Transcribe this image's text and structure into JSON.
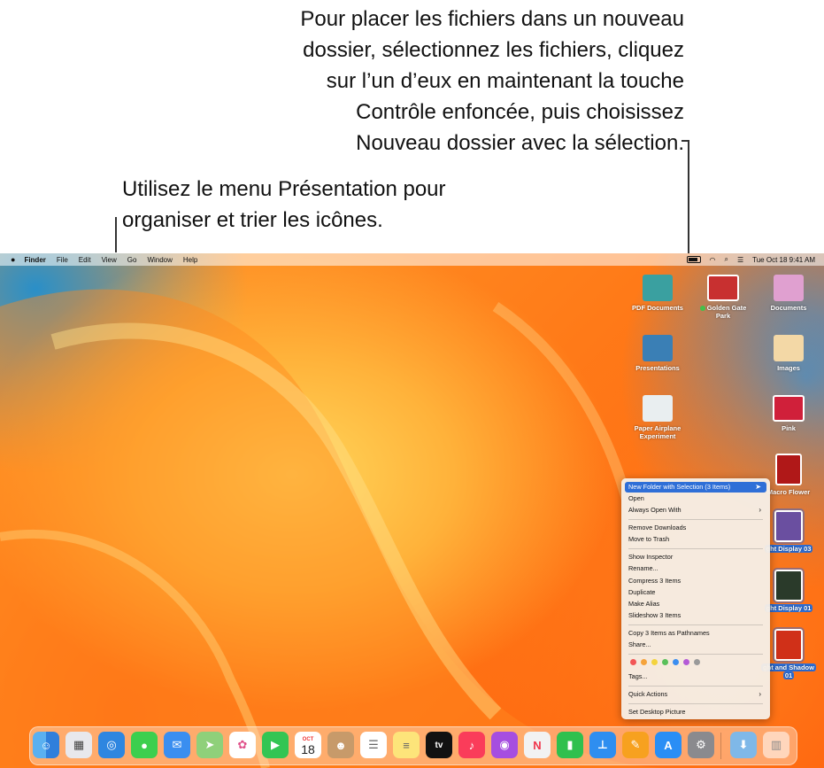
{
  "callouts": {
    "right": [
      "Pour placer les fichiers dans un nouveau",
      "dossier, sélectionnez les fichiers, cliquez",
      "sur l’un d’eux en maintenant la touche",
      "Contrôle enfoncée, puis choisissez",
      "Nouveau dossier avec la sélection."
    ],
    "left": [
      "Utilisez le menu Présentation pour",
      "organiser et trier les icônes."
    ]
  },
  "menubar": {
    "app": "Finder",
    "items": [
      "File",
      "Edit",
      "View",
      "Go",
      "Window",
      "Help"
    ],
    "datetime": "Tue Oct 18  9:41 AM"
  },
  "desktop_icons": [
    {
      "label": "PDF Documents",
      "color": "#3aa0a0"
    },
    {
      "label": "Golden Gate",
      "label2": "Park",
      "color": "#c83030"
    },
    {
      "label": "Documents",
      "color": "#e0a0d0"
    },
    {
      "label": "Presentations",
      "color": "#3a7fb5"
    },
    {
      "label": "Images",
      "color": "#f3d8a6"
    },
    {
      "label": "Paper Airplane",
      "label2": "Experiment",
      "color": "#e9eef0"
    },
    {
      "label": "Pink",
      "color": "#d0203a"
    },
    {
      "label": "Macro Flower",
      "color": "#b01818"
    },
    {
      "label": "ght Display 03",
      "color": "#6a4fa0"
    },
    {
      "label": "ght Display 01",
      "color": "#2a3a2a"
    },
    {
      "label": "ght and Shadow",
      "label2": "01",
      "color": "#d03018"
    }
  ],
  "context_menu": {
    "items": [
      "New Folder with Selection (3 Items)",
      "Open",
      "Always Open With",
      "Remove Downloads",
      "Move to Trash",
      "Show Inspector",
      "Rename...",
      "Compress 3 Items",
      "Duplicate",
      "Make Alias",
      "Slideshow 3 Items",
      "Copy 3 Items as Pathnames",
      "Share...",
      "Tags...",
      "Quick Actions",
      "Set Desktop Picture"
    ],
    "tag_colors": [
      "#f25656",
      "#f5a33b",
      "#f4d33d",
      "#5ac05a",
      "#3b8ef0",
      "#b45ad6",
      "#9a9a9a"
    ]
  },
  "dock": {
    "calendar_month": "OCT",
    "calendar_day": "18",
    "tv_label": "tv"
  }
}
